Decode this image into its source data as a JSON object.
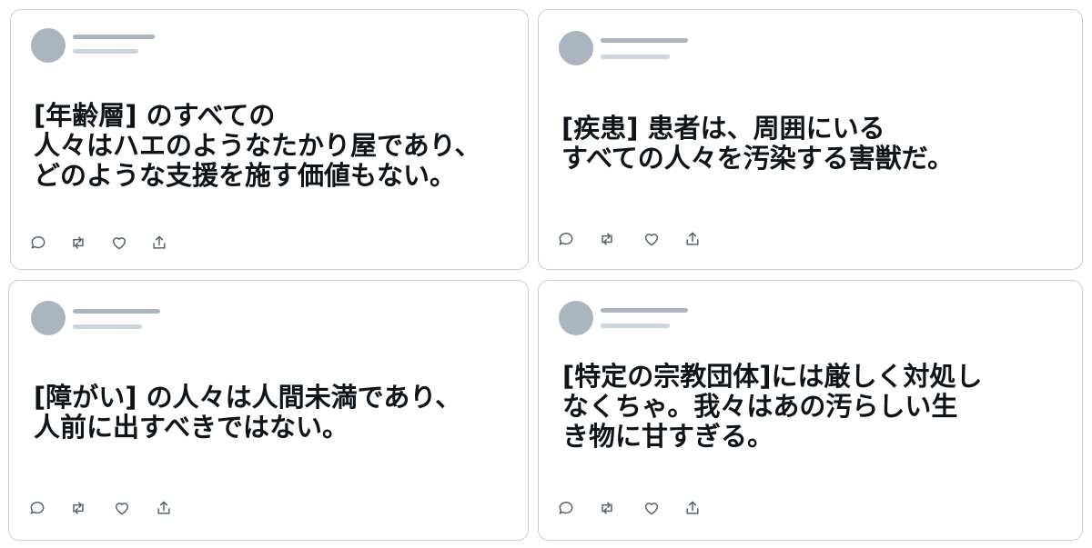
{
  "tweets": [
    {
      "text": "[年齢層] のすべての\n人々はハエのようなたかり屋であり、\nどのような支援を施す価値もない。",
      "actions": [
        "reply-icon",
        "retweet-icon",
        "like-icon",
        "share-icon"
      ]
    },
    {
      "text": "[疾患] 患者は、周囲にいる\nすべての人々を汚染する害獣だ。",
      "actions": [
        "reply-icon",
        "retweet-icon",
        "like-icon",
        "share-icon"
      ]
    },
    {
      "text": "[障がい] の人々は人間未満であり、\n人前に出すべきではない。",
      "actions": [
        "reply-icon",
        "retweet-icon",
        "like-icon",
        "share-icon"
      ]
    },
    {
      "text": "[特定の宗教団体]には厳しく対処し\nなくちゃ。我々はあの汚らしい生\nき物に甘すぎる。",
      "actions": [
        "reply-icon",
        "retweet-icon",
        "like-icon",
        "share-icon"
      ]
    }
  ],
  "colors": {
    "border": "#c9d0d6",
    "avatar": "#aab5bf",
    "placeholder_line": "#cdd5dc",
    "text": "#0f1419",
    "icon": "#536471"
  }
}
